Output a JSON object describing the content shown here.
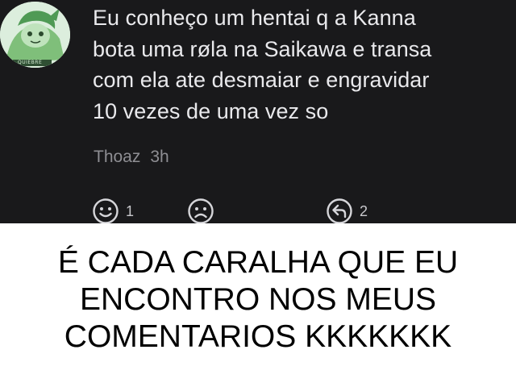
{
  "comment": {
    "avatar_icon": "anime-avatar-icon",
    "avatar_badge": "QUIEBRE",
    "lines": [
      "Eu conheço um hentai q a Kanna",
      "bota uma røla na Saikawa e transa",
      "com ela ate desmaiar e engravidar",
      "10 vezes de uma vez so"
    ],
    "author": "Thoaz",
    "time": "3h"
  },
  "actions": {
    "like": {
      "icon": "smiley-face-icon",
      "count": "1"
    },
    "dislike": {
      "icon": "sad-face-icon"
    },
    "reply": {
      "icon": "reply-icon",
      "count": "2"
    }
  },
  "caption": {
    "lines": [
      "É CADA CARALHA QUE EU",
      "ENCONTRO NOS MEUS",
      "COMENTARIOS KKKKKKK"
    ]
  },
  "colors": {
    "card_background": "#19191b",
    "comment_text": "#e9e9ec",
    "meta_text": "#8e8e93",
    "caption_text": "#000000"
  }
}
